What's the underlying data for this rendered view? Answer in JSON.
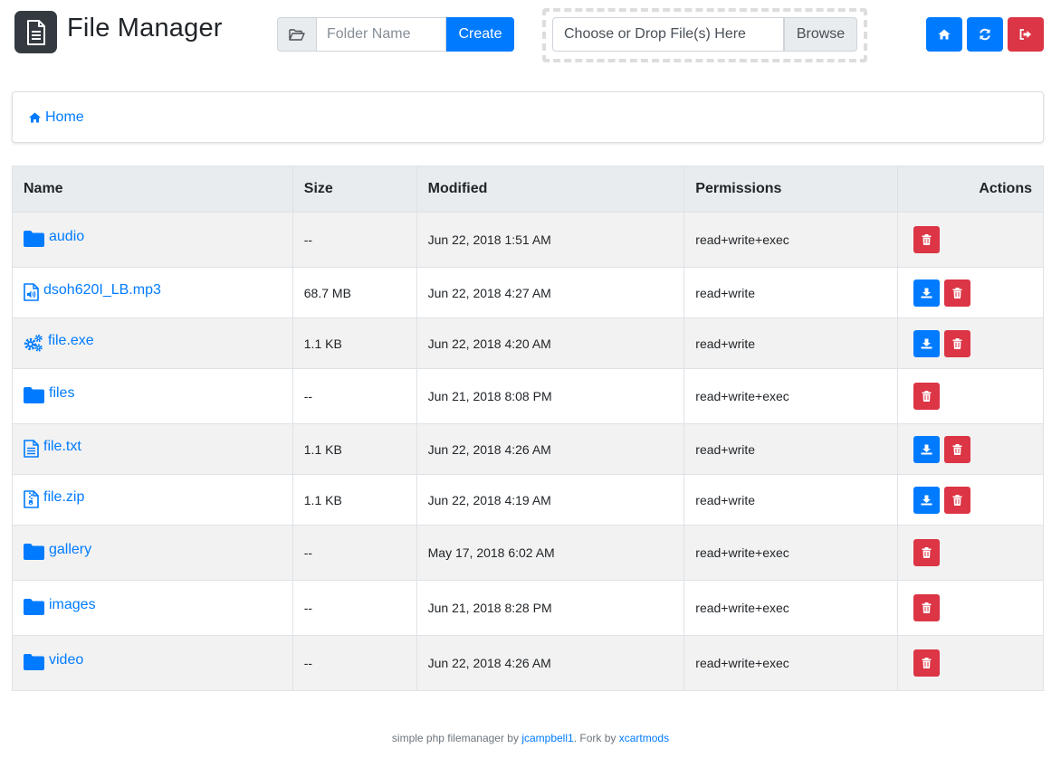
{
  "app": {
    "title": "File Manager"
  },
  "header": {
    "folder_placeholder": "Folder Name",
    "create_label": "Create",
    "upload_label": "Choose or Drop File(s) Here",
    "browse_label": "Browse",
    "buttons": [
      "home-icon",
      "refresh-icon",
      "logout-icon"
    ]
  },
  "breadcrumb": {
    "home_label": "Home"
  },
  "table": {
    "headers": {
      "name": "Name",
      "size": "Size",
      "modified": "Modified",
      "permissions": "Permissions",
      "actions": "Actions"
    },
    "rows": [
      {
        "name": "audio",
        "icon": "folder-icon",
        "size": "--",
        "modified": "Jun 22, 2018 1:51 AM",
        "permissions": "read+write+exec",
        "download": false
      },
      {
        "name": "dsoh620I_LB.mp3",
        "icon": "audio-file-icon",
        "size": "68.7 MB",
        "modified": "Jun 22, 2018 4:27 AM",
        "permissions": "read+write",
        "download": true
      },
      {
        "name": "file.exe",
        "icon": "gears-icon",
        "size": "1.1 KB",
        "modified": "Jun 22, 2018 4:20 AM",
        "permissions": "read+write",
        "download": true
      },
      {
        "name": "files",
        "icon": "folder-icon",
        "size": "--",
        "modified": "Jun 21, 2018 8:08 PM",
        "permissions": "read+write+exec",
        "download": false
      },
      {
        "name": "file.txt",
        "icon": "text-file-icon",
        "size": "1.1 KB",
        "modified": "Jun 22, 2018 4:26 AM",
        "permissions": "read+write",
        "download": true
      },
      {
        "name": "file.zip",
        "icon": "zip-file-icon",
        "size": "1.1 KB",
        "modified": "Jun 22, 2018 4:19 AM",
        "permissions": "read+write",
        "download": true
      },
      {
        "name": "gallery",
        "icon": "folder-icon",
        "size": "--",
        "modified": "May 17, 2018 6:02 AM",
        "permissions": "read+write+exec",
        "download": false
      },
      {
        "name": "images",
        "icon": "folder-icon",
        "size": "--",
        "modified": "Jun 21, 2018 8:28 PM",
        "permissions": "read+write+exec",
        "download": false
      },
      {
        "name": "video",
        "icon": "folder-icon",
        "size": "--",
        "modified": "Jun 22, 2018 4:26 AM",
        "permissions": "read+write+exec",
        "download": false
      }
    ]
  },
  "footer": {
    "prefix": "simple php filemanager by ",
    "author": "jcampbell1",
    "middle": ". Fork by ",
    "fork_author": "xcartmods"
  },
  "colors": {
    "primary": "#007bff",
    "danger": "#dc3545",
    "logo_bg": "#343a40"
  }
}
